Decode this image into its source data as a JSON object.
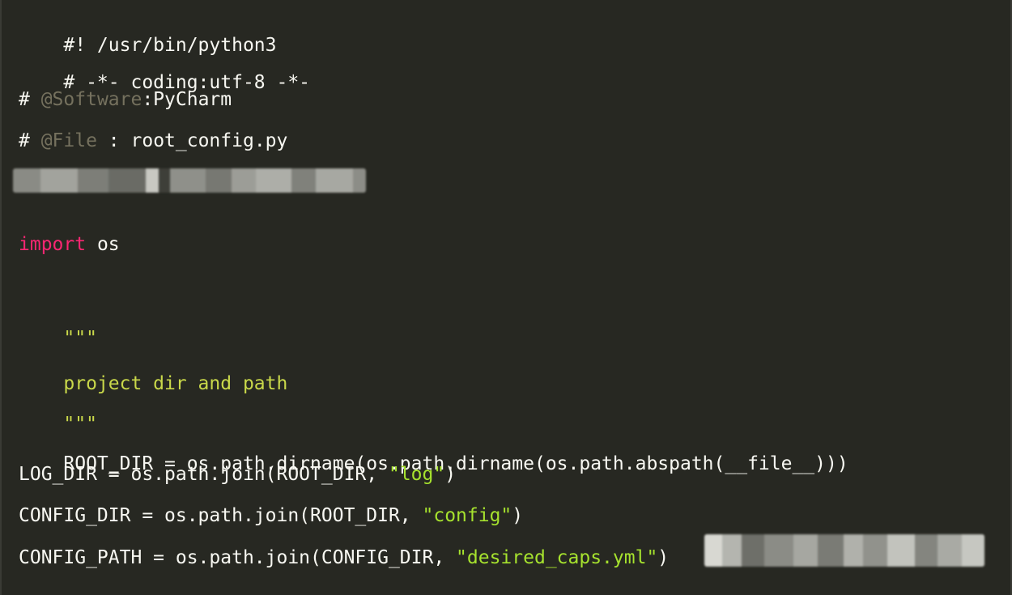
{
  "code": {
    "line1": "#! /usr/bin/python3",
    "line2": "# -*- coding:utf-8 -*-",
    "line3": {
      "prefix": "# ",
      "tag": "@Software",
      "rest": ":PyCharm"
    },
    "line4": {
      "prefix": "# ",
      "tag": "@File",
      "rest": " : root_config.py"
    },
    "import_line": {
      "keyword": "import",
      "module": " os"
    },
    "doc_open": "\"\"\"",
    "doc_text": "project dir and path",
    "doc_close": "\"\"\"",
    "root_dir": "ROOT_DIR = os.path.dirname(os.path.dirname(os.path.abspath(__file__)))",
    "log_dir": {
      "code": "LOG_DIR = os.path.join(ROOT_DIR, ",
      "string": "\"log\"",
      "close": ")"
    },
    "config_dir": {
      "code": "CONFIG_DIR = os.path.join(ROOT_DIR, ",
      "string": "\"config\"",
      "close": ")"
    },
    "config_path": {
      "code": "CONFIG_PATH = os.path.join(CONFIG_DIR, ",
      "string": "\"desired_caps.yml\"",
      "close": ")"
    }
  },
  "colors": {
    "background": "#272822",
    "text": "#f8f8f2",
    "keyword": "#f92672",
    "string": "#a6e22e",
    "comment_tag": "#75715e"
  }
}
